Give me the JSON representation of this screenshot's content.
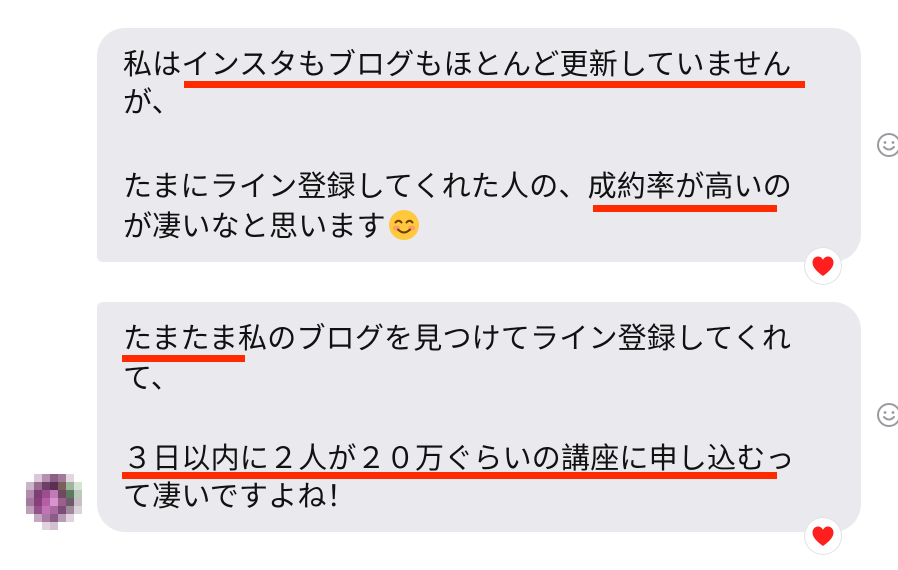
{
  "messages": [
    {
      "lines": [
        "私はインスタもブログもほとんど更新していません",
        "が、",
        "たまにライン登録してくれた人の、成約率が高いの",
        "が凄いなと思います"
      ],
      "emoji": "smiling-face-icon",
      "reaction": "heart-icon"
    },
    {
      "lines": [
        "たまたま私のブログを見つけてライン登録してくれ",
        "て、",
        "３日以内に２人が２０万ぐらいの講座に申し込むっ",
        "て凄いですよね！"
      ],
      "reaction": "heart-icon"
    }
  ],
  "colors": {
    "bubble": "#e9e9ee",
    "underline": "#ff2a00",
    "heart": "#ff1f1f"
  }
}
